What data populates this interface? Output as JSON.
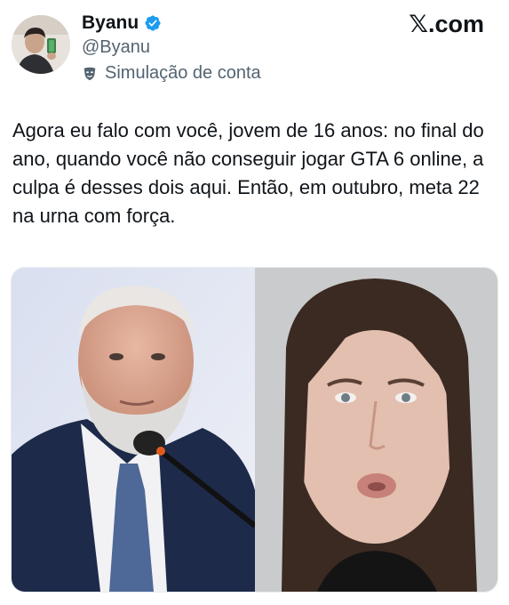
{
  "tweet": {
    "author": {
      "display_name": "Byanu",
      "handle": "@Byanu",
      "verified": true,
      "avatar_icon": "profile-photo"
    },
    "account_label": {
      "icon": "theater-mask-icon",
      "text": "Simulação de conta"
    },
    "brand": "𝕏.com",
    "text": "Agora eu falo com você, jovem de 16 anos: no final do ano, quando você não conseguir jogar GTA 6 online, a culpa é desses dois aqui. Então, em outubro, meta 22 na urna com força.",
    "media": {
      "count": 2
    }
  },
  "colors": {
    "verified": "#1d9bf0",
    "secondary_text": "#536471",
    "primary_text": "#0f1419"
  }
}
